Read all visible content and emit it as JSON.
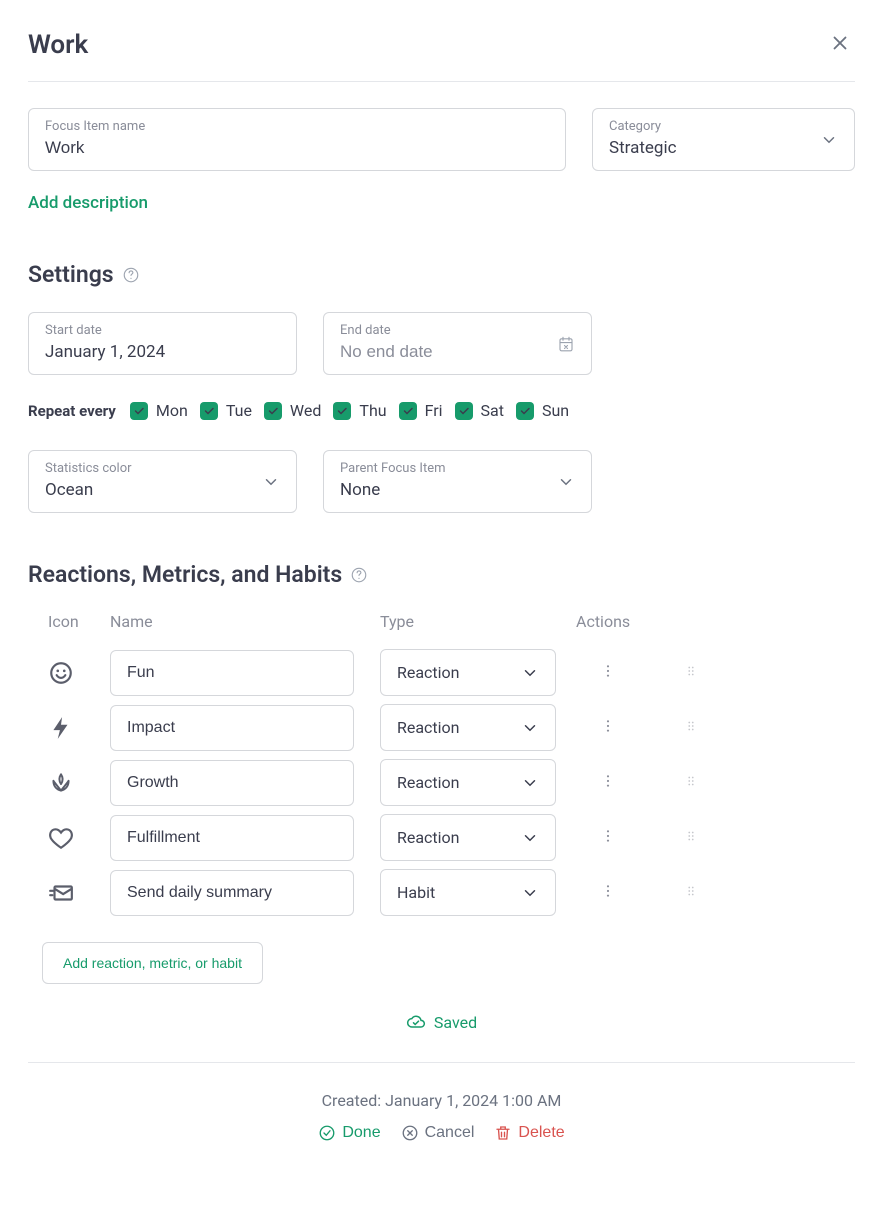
{
  "header": {
    "title": "Work"
  },
  "fields": {
    "name_label": "Focus Item name",
    "name_value": "Work",
    "category_label": "Category",
    "category_value": "Strategic"
  },
  "add_description": "Add description",
  "settings": {
    "heading": "Settings",
    "start_date_label": "Start date",
    "start_date_value": "January 1, 2024",
    "end_date_label": "End date",
    "end_date_placeholder": "No end date",
    "repeat_label": "Repeat every",
    "days": [
      "Mon",
      "Tue",
      "Wed",
      "Thu",
      "Fri",
      "Sat",
      "Sun"
    ],
    "stats_color_label": "Statistics color",
    "stats_color_value": "Ocean",
    "parent_label": "Parent Focus Item",
    "parent_value": "None"
  },
  "reactions": {
    "heading": "Reactions, Metrics, and Habits",
    "columns": {
      "icon": "Icon",
      "name": "Name",
      "type": "Type",
      "actions": "Actions"
    },
    "rows": [
      {
        "icon": "smile",
        "name": "Fun",
        "type": "Reaction"
      },
      {
        "icon": "bolt",
        "name": "Impact",
        "type": "Reaction"
      },
      {
        "icon": "lotus",
        "name": "Growth",
        "type": "Reaction"
      },
      {
        "icon": "heart",
        "name": "Fulfillment",
        "type": "Reaction"
      },
      {
        "icon": "mail-send",
        "name": "Send daily summary",
        "type": "Habit"
      }
    ],
    "add_button": "Add reaction, metric, or habit"
  },
  "saved_text": "Saved",
  "footer": {
    "created": "Created: January 1, 2024 1:00 AM",
    "done": "Done",
    "cancel": "Cancel",
    "delete": "Delete"
  }
}
